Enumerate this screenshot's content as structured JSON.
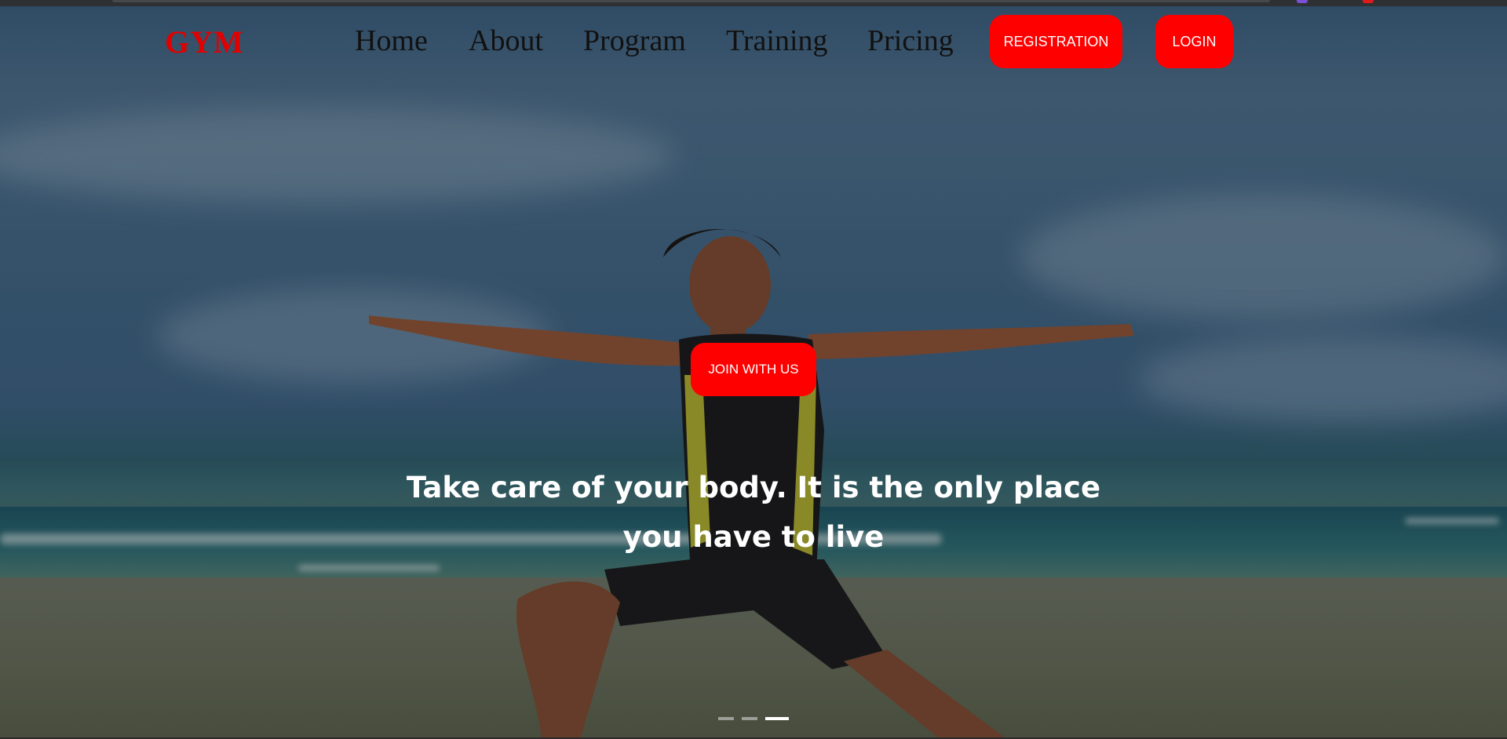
{
  "nav": {
    "logo": "GYM",
    "links": [
      "Home",
      "About",
      "Program",
      "Training",
      "Pricing"
    ],
    "registration_label": "REGISTRATION",
    "login_label": "LOGIN"
  },
  "hero": {
    "cta_label": "JOIN WITH US",
    "tagline": "Take care of your body. It is the only place you have to live",
    "slide_count": 3,
    "active_slide": 3
  },
  "colors": {
    "accent": "#ff0000",
    "logo": "#e00000",
    "nav_text": "#111111",
    "tagline": "#ffffff"
  }
}
